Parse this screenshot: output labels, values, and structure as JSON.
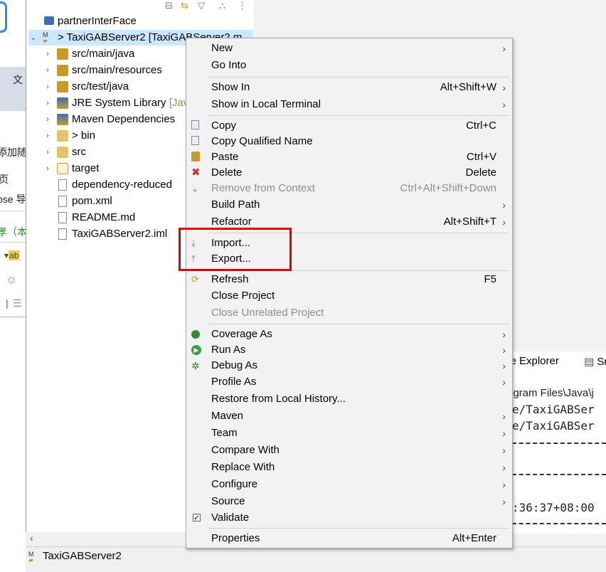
{
  "left_strip": {
    "tab_char": "文",
    "text1": "添加随",
    "text2": "页",
    "text3": "pse 导",
    "text4": "孝（本"
  },
  "explorer": {
    "items": [
      {
        "label": "partnerInterFace",
        "suffix": ""
      },
      {
        "label": "> TaxiGABServer2 [TaxiGABServer2 m",
        "suffix": ""
      },
      {
        "label": "src/main/java",
        "suffix": ""
      },
      {
        "label": "src/main/resources",
        "suffix": ""
      },
      {
        "label": "src/test/java",
        "suffix": ""
      },
      {
        "label": "JRE System Library ",
        "suffix": "[Jav"
      },
      {
        "label": "Maven Dependencies",
        "suffix": ""
      },
      {
        "label": "> bin",
        "suffix": ""
      },
      {
        "label": "src",
        "suffix": ""
      },
      {
        "label": "target",
        "suffix": ""
      },
      {
        "label": "dependency-reduced",
        "suffix": ""
      },
      {
        "label": "pom.xml",
        "suffix": ""
      },
      {
        "label": "README.md",
        "suffix": ""
      },
      {
        "label": "TaxiGABServer2.iml",
        "suffix": ""
      }
    ]
  },
  "right_pane": {
    "tab1": "rce Explorer",
    "tab2": "Sn",
    "console": {
      "line1": "rogram Files\\Java\\j",
      "line2": "e/TaxiGABSer",
      "line3": "e/TaxiGABSer",
      "line4": ":36:37+08:00"
    }
  },
  "status": {
    "label": "TaxiGABServer2"
  },
  "menu": {
    "new": "New",
    "go_into": "Go Into",
    "show_in": "Show In",
    "show_in_sc": "Alt+Shift+W",
    "show_local_terminal": "Show in Local Terminal",
    "copy": "Copy",
    "copy_sc": "Ctrl+C",
    "copy_qualified": "Copy Qualified Name",
    "paste": "Paste",
    "paste_sc": "Ctrl+V",
    "delete": "Delete",
    "delete_sc": "Delete",
    "remove_context": "Remove from Context",
    "remove_context_sc": "Ctrl+Alt+Shift+Down",
    "build_path": "Build Path",
    "refactor": "Refactor",
    "refactor_sc": "Alt+Shift+T",
    "import": "Import...",
    "export": "Export...",
    "refresh": "Refresh",
    "refresh_sc": "F5",
    "close_project": "Close Project",
    "close_unrelated": "Close Unrelated Project",
    "coverage_as": "Coverage As",
    "run_as": "Run As",
    "debug_as": "Debug As",
    "profile_as": "Profile As",
    "restore_history": "Restore from Local History...",
    "maven": "Maven",
    "team": "Team",
    "compare_with": "Compare With",
    "replace_with": "Replace With",
    "configure": "Configure",
    "source": "Source",
    "validate": "Validate",
    "properties": "Properties",
    "properties_sc": "Alt+Enter"
  },
  "colors": {
    "highlight": "#e50000",
    "selection": "#cce8ff"
  }
}
